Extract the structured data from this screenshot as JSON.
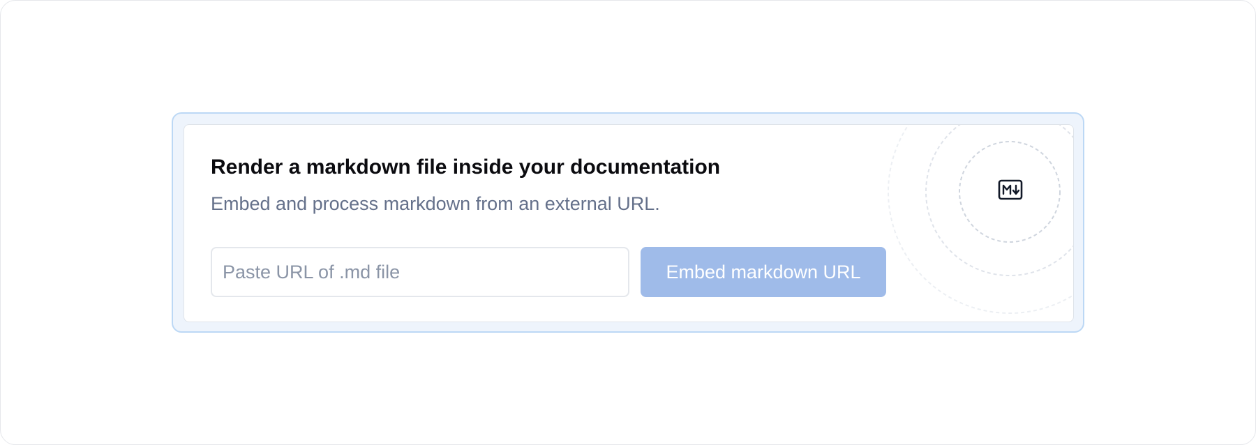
{
  "embed": {
    "title": "Render a markdown file inside your documentation",
    "subtitle": "Embed and process markdown from an external URL.",
    "input": {
      "placeholder": "Paste URL of .md file",
      "value": ""
    },
    "button_label": "Embed markdown URL",
    "icon": "markdown-icon"
  },
  "colors": {
    "outer_background": "#eef4fc",
    "outer_border": "#bcd8f5",
    "button_background": "#9fbbe9",
    "subtitle_text": "#64708a"
  }
}
